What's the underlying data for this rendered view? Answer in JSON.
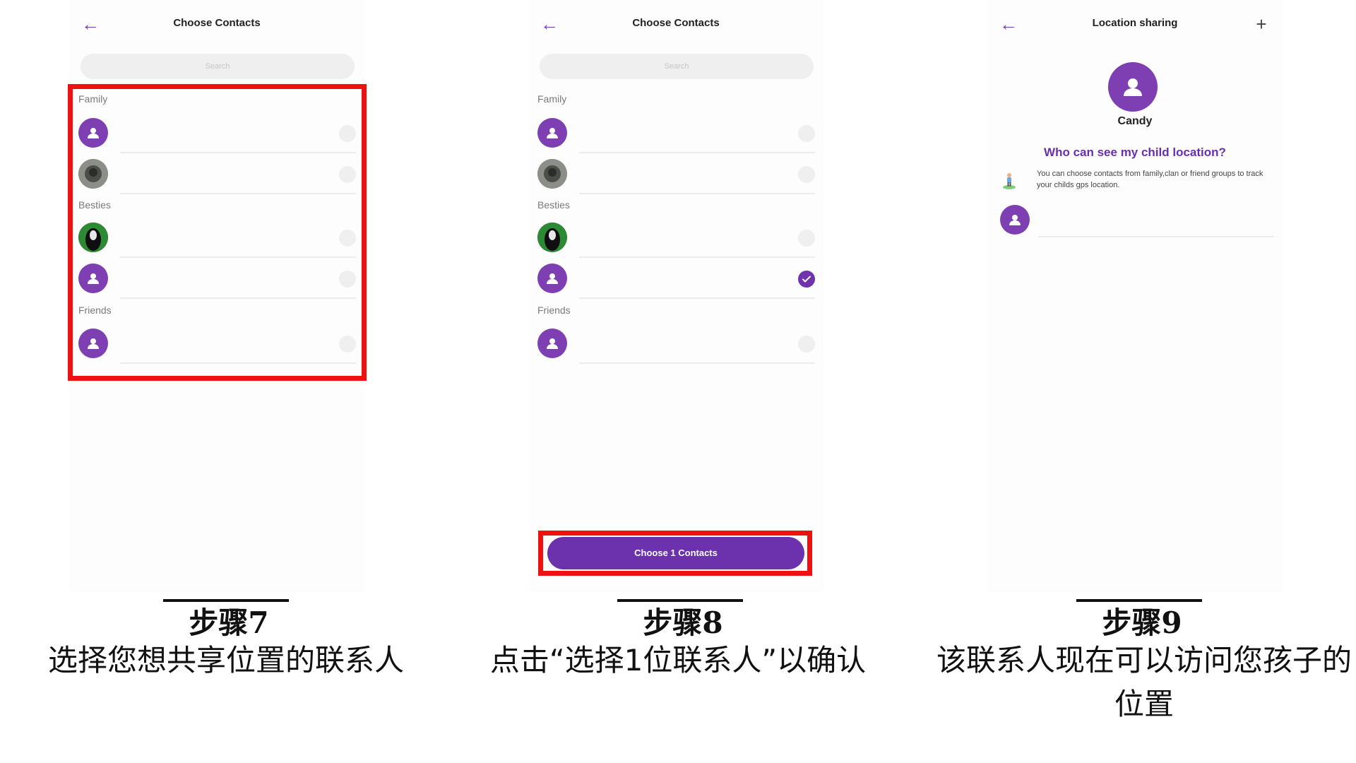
{
  "panel1": {
    "title": "Choose Contacts",
    "search_placeholder": "Search",
    "groups": [
      "Family",
      "Besties",
      "Friends"
    ]
  },
  "panel2": {
    "title": "Choose Contacts",
    "search_placeholder": "Search",
    "groups": [
      "Family",
      "Besties",
      "Friends"
    ],
    "button_label": "Choose 1 Contacts"
  },
  "panel3": {
    "title": "Location sharing",
    "user_name": "Candy",
    "question": "Who can see my child location?",
    "description": "You can choose contacts from family,clan or friend groups to track your childs gps location."
  },
  "captions": {
    "step7": "步骤7",
    "text7": "选择您想共享位置的联系人",
    "step8": "步骤8",
    "text8": "点击“选择1位联系人”以确认",
    "step9": "步骤9",
    "text9": "该联系人现在可以访问您孩子的位置"
  },
  "colors": {
    "accent": "#6c31ad",
    "highlight": "#ee1111"
  }
}
